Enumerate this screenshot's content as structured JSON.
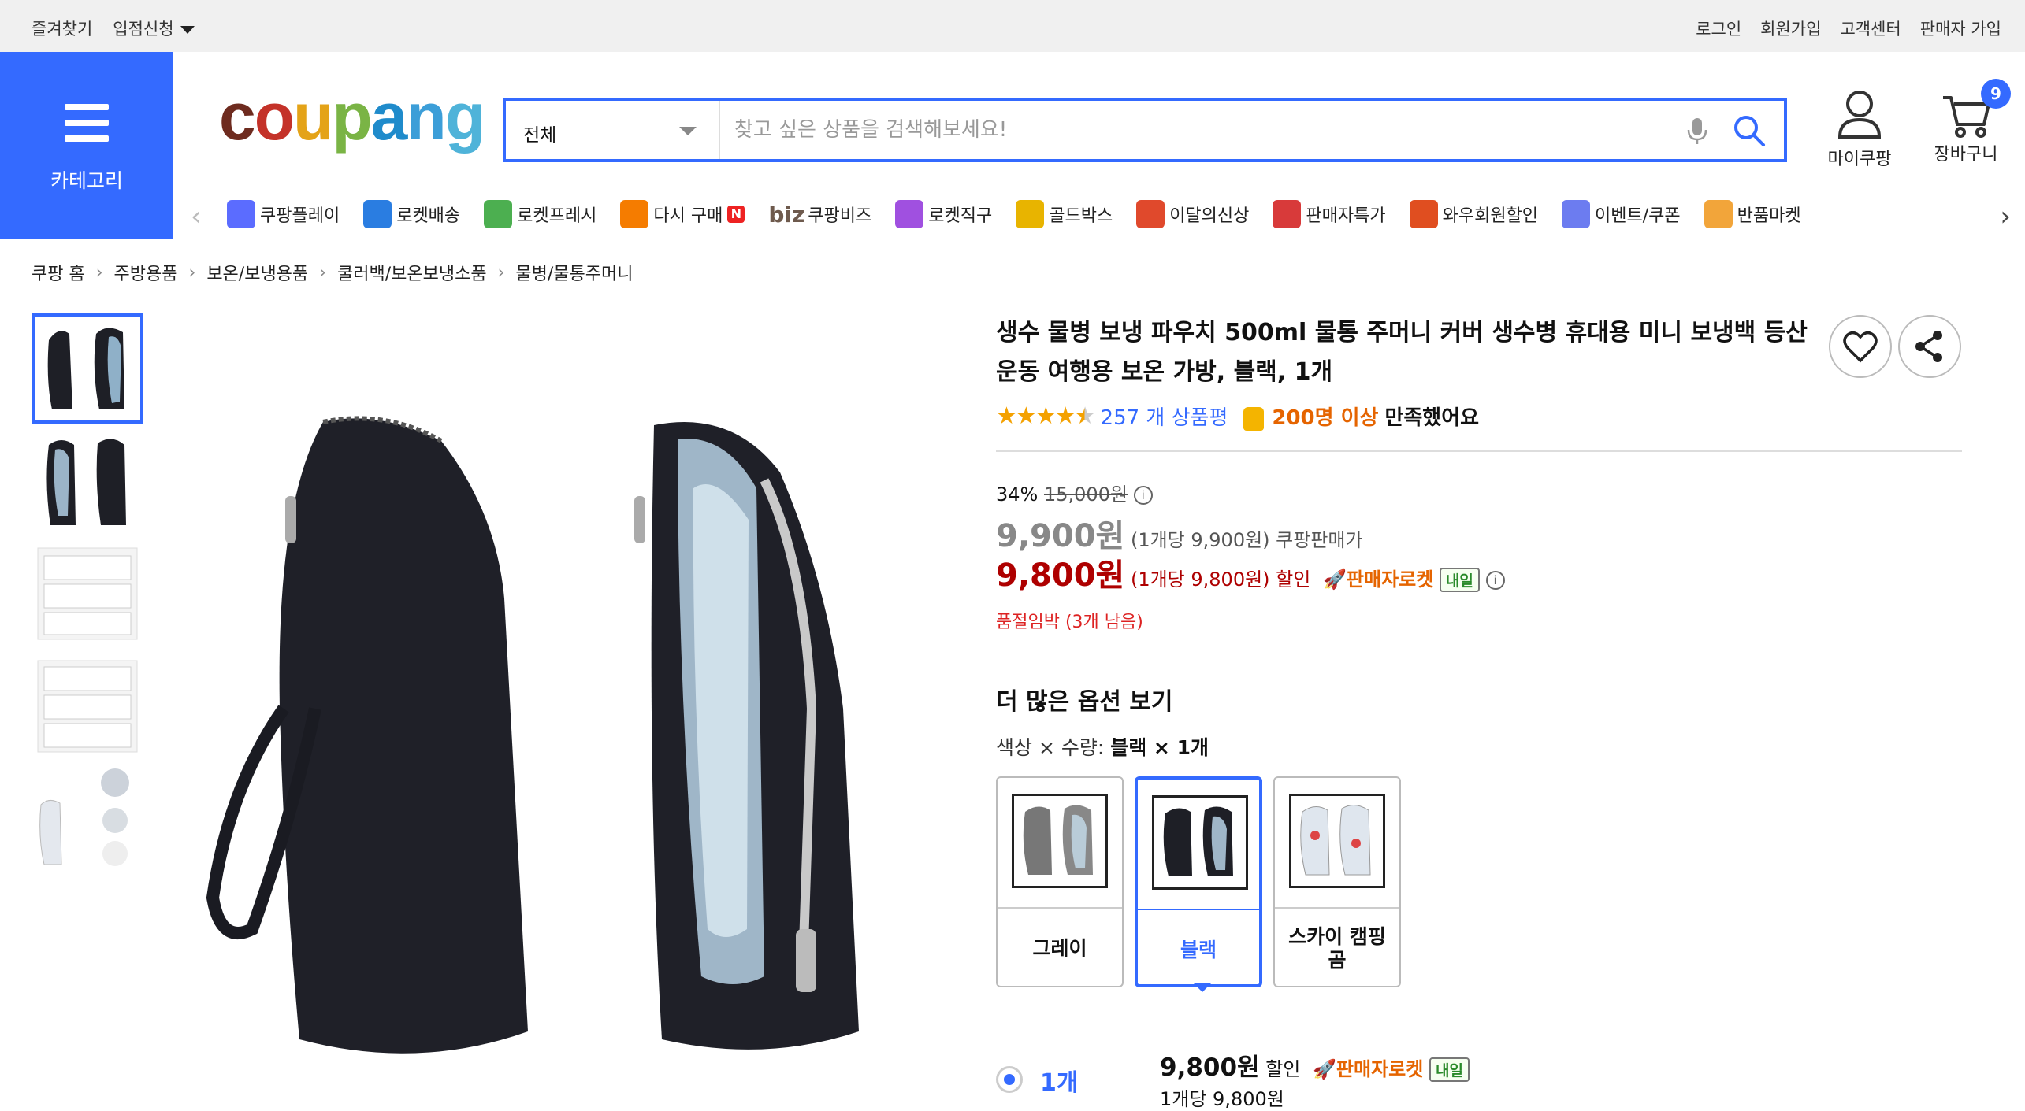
{
  "topbar": {
    "favorites": "즐겨찾기",
    "entry": "입점신청",
    "login": "로그인",
    "signup": "회원가입",
    "support": "고객센터",
    "seller": "판매자 가입"
  },
  "category": {
    "label": "카테고리"
  },
  "logo": {
    "letters": [
      "c",
      "o",
      "u",
      "p",
      "a",
      "n",
      "g"
    ],
    "colors": [
      "#6e2b1f",
      "#c43229",
      "#e4a318",
      "#7ab445",
      "#1f8bcb",
      "#3c9ed8",
      "#4fb3d9"
    ]
  },
  "search": {
    "category": "전체",
    "placeholder": "찾고 싶은 상품을 검색해보세요!"
  },
  "header": {
    "mypage": "마이쿠팡",
    "cart": "장바구니",
    "cart_count": "9"
  },
  "nav": [
    {
      "label": "쿠팡플레이",
      "icon": "play-icon",
      "color": "#5b6cff"
    },
    {
      "label": "로켓배송",
      "icon": "rocket-icon",
      "color": "#2a7de1"
    },
    {
      "label": "로켓프레시",
      "icon": "rocket-fresh-icon",
      "color": "#4caf50"
    },
    {
      "label": "다시 구매",
      "icon": "rebuy-icon",
      "color": "#f57c00"
    },
    {
      "label": "쿠팡비즈",
      "icon": "biz-icon",
      "color": "#6e5a4d"
    },
    {
      "label": "로켓직구",
      "icon": "global-rocket-icon",
      "color": "#a050e0"
    },
    {
      "label": "골드박스",
      "icon": "goldbox-icon",
      "color": "#e8b400"
    },
    {
      "label": "이달의신상",
      "icon": "new-bag-icon",
      "color": "#e0492c"
    },
    {
      "label": "판매자특가",
      "icon": "percent-icon",
      "color": "#d83a3a"
    },
    {
      "label": "와우회원할인",
      "icon": "wow-icon",
      "color": "#e04e20"
    },
    {
      "label": "이벤트/쿠폰",
      "icon": "coupon-icon",
      "color": "#6c7cf0"
    },
    {
      "label": "반품마켓",
      "icon": "return-market-icon",
      "color": "#f2a53a"
    }
  ],
  "nav_extra": {
    "rebuy_badge": "N",
    "biz_prefix": "biz"
  },
  "breadcrumb": [
    "쿠팡 홈",
    "주방용품",
    "보온/보냉용품",
    "쿨러백/보온보냉소품",
    "물병/물통주머니"
  ],
  "product": {
    "title": "생수 물병 보냉 파우치 500ml 물통 주머니 커버 생수병 휴대용 미니 보냉백 등산 운동 여행용 보온 가방, 블랙, 1개",
    "rating": 4.5,
    "review_count": "257 개 상품평",
    "satisfaction": "200명 이상",
    "satisfaction_suffix": "만족했어요",
    "discount": "34%",
    "original_price": "15,000원",
    "price_coupang": "9,900원",
    "price_coupang_unit": "(1개당 9,900원) 쿠팡판매가",
    "price_sale": "9,800원",
    "price_sale_unit": "(1개당 9,800원) 할인",
    "seller_rocket": "판매자로켓",
    "delivery_tag": "내일",
    "stock": "품절임박 (3개 남음)"
  },
  "options": {
    "heading": "더 많은 옵션 보기",
    "label": "색상 × 수량:",
    "selected": "블랙 × 1개",
    "items": [
      {
        "name": "그레이",
        "color": "#777"
      },
      {
        "name": "블랙",
        "color": "#1e1f26"
      },
      {
        "name": "스카이 캠핑곰",
        "color": "#c8d6e5"
      }
    ]
  },
  "quantity": {
    "label": "1개",
    "price": "9,800원",
    "discount_word": "할인",
    "rocket": "판매자로켓",
    "tag": "내일",
    "per_unit": "1개당 9,800원"
  }
}
